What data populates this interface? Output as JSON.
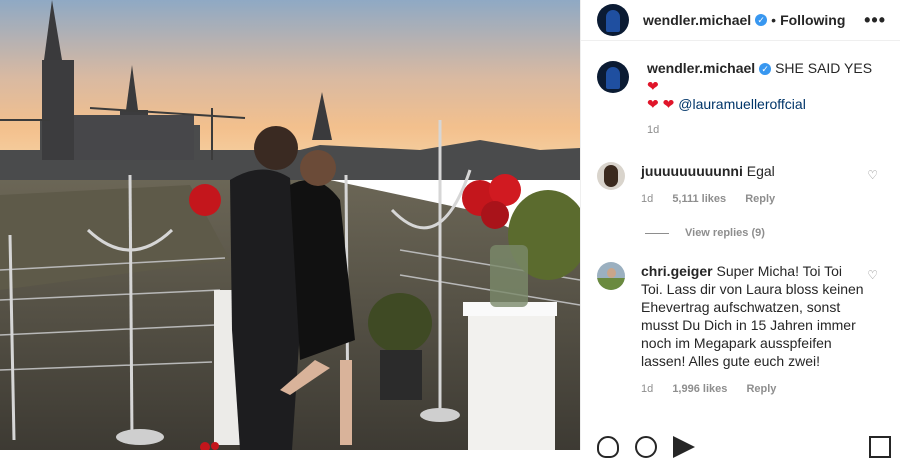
{
  "post": {
    "username": "wendler.michael",
    "follow_status": "Following",
    "caption_text": "SHE SAID YES",
    "caption_mention": "@lauramuelleroffcial",
    "caption_time": "1d"
  },
  "comments": [
    {
      "username": "juuuuuuuuunni",
      "text": "Egal",
      "time": "1d",
      "likes": "5,111 likes",
      "reply_label": "Reply",
      "view_replies": "View replies (9)"
    },
    {
      "username": "chri.geiger",
      "text": "Super Micha! Toi Toi Toi. Lass dir von Laura bloss keinen Ehevertrag aufschwatzen, sonst musst Du Dich in 15 Jahren immer noch im Megapark ausspfeifen lassen! Alles gute euch zwei!",
      "time": "1d",
      "likes": "1,996 likes",
      "reply_label": "Reply"
    }
  ]
}
